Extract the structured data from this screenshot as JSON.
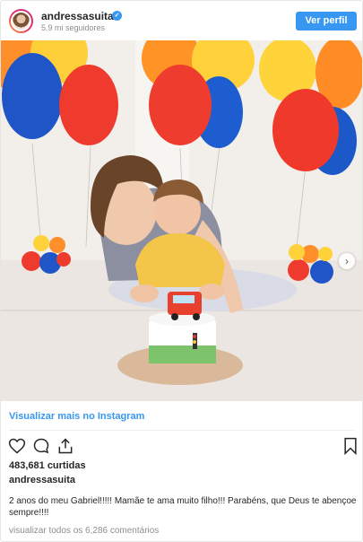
{
  "header": {
    "username": "andressasuita",
    "followers": "5.9 mi seguidores",
    "profile_button": "Ver perfil"
  },
  "photo": {
    "description_icon": "photo-carousel"
  },
  "more_link": "Visualizar mais no Instagram",
  "likes": "483,681 curtidas",
  "caption": {
    "username": "andressasuita",
    "text": "2 anos do meu Gabriel!!!!! Mamãe te ama muito filho!!! Parabéns, que Deus te abençoe sempre!!!!"
  },
  "comments_link": "visualizar todos os 6,286 comentários",
  "colors": {
    "accent": "#3897f0",
    "text": "#262626",
    "muted": "#8e8e8e"
  }
}
